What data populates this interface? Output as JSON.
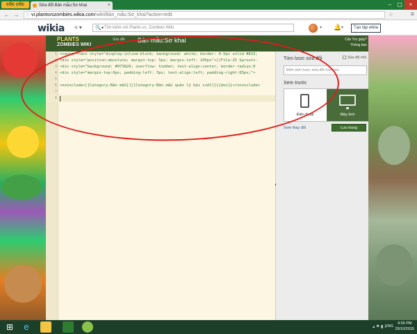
{
  "browser": {
    "brand": "cốc cốc",
    "tab_title": "Sửa đổi Bản mẫu:Sơ khai",
    "url_host": "vi.plantsvszombies.wikia.com",
    "url_path": "/wiki/Bản_mẫu:Sơ_khai?action=edit"
  },
  "wikia": {
    "logo": "wikia",
    "search_placeholder": "Tìm kiếm với Plants vs. Zombies Wiki",
    "create_wiki": "Tạo lập wikia"
  },
  "editor": {
    "wiki_logo_line1": "PLANTS",
    "wiki_logo_line2": "ZOMBIES WIKI",
    "subtitle": "Sửa đổi",
    "title": "Bản mẫu:Sơ khai",
    "help_label": "Cần Trợ giúp?",
    "notice_label": "Thông báo",
    "lines": [
      {
        "n": "1",
        "code": "<center><div style=\"display:inline-block; background: white; border: 0.5px solid #833;"
      },
      {
        "n": "2",
        "code": "<div style=\"position:absolute; margin-top: 5px; margin-left: 245px\">[[File:25 Sprouts-"
      },
      {
        "n": "3",
        "code": "<div style=\"background: #973826; overflow: hidden; text-align:center; border-radius:0"
      },
      {
        "n": "4",
        "code": "<div style=\"margin-top:0px; padding-left: 5px; text-align:left; padding-right:65px;\">"
      },
      {
        "n": "5",
        "code": ""
      },
      {
        "n": "6",
        "code": "<noinclude>[[Category:Bản mẫu]][[Category:Bản mẫu quản lý bài viết]]{{doc}}</noinclude>"
      },
      {
        "n": "7",
        "code": ""
      },
      {
        "n": "8",
        "code": ""
      }
    ]
  },
  "panel": {
    "summary_title": "Tóm lược sửa đổi",
    "minor_edit": "Sửa đổi nhỏ",
    "summary_placeholder": "Điền tóm lược sửa đổi của bạn",
    "preview_label": "Xem trước",
    "phone_label": "Điện thoại",
    "desktop_label": "Máy tính",
    "show_changes": "Xem thay đổi",
    "save": "Lưu trang"
  },
  "taskbar": {
    "language": "ENG",
    "time": "4:55 PM",
    "date": "29/10/2015"
  },
  "colors": {
    "annotation": "#e01b1b",
    "editor_bg": "#fdf6e3",
    "code_text": "#2e7d32",
    "save_button": "#3e6e2e"
  }
}
